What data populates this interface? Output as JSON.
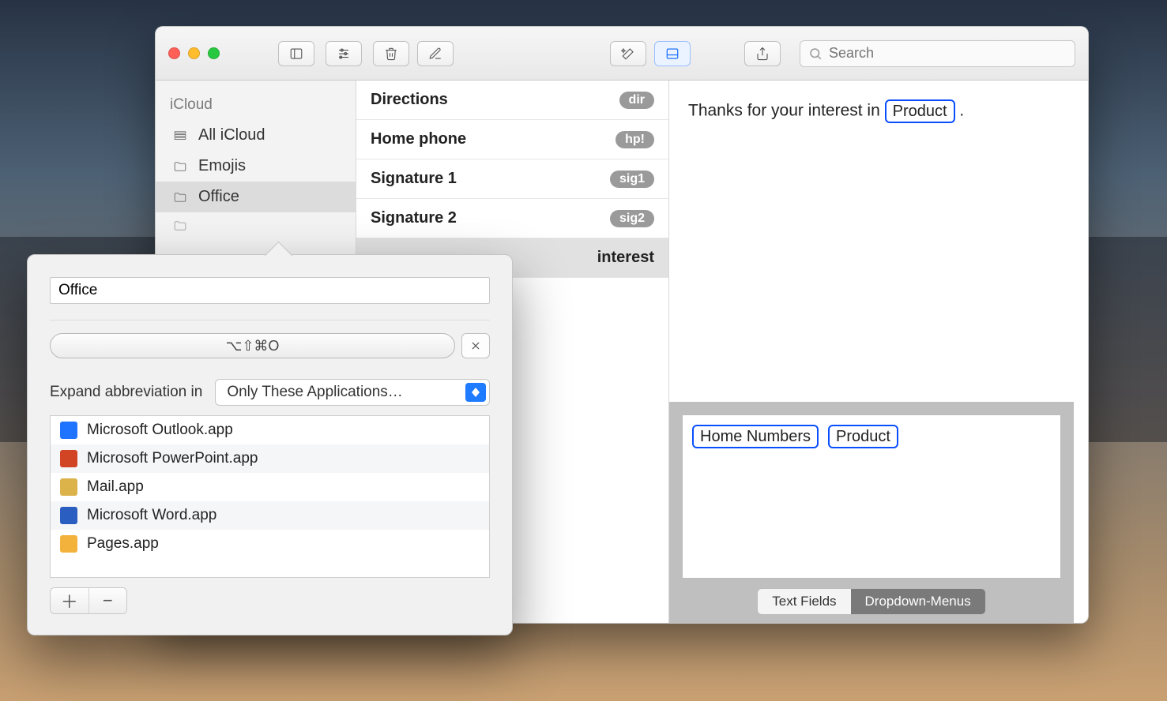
{
  "toolbar": {
    "search_placeholder": "Search"
  },
  "sidebar": {
    "group": "iCloud",
    "items": [
      {
        "label": "All iCloud"
      },
      {
        "label": "Emojis"
      },
      {
        "label": "Office"
      }
    ]
  },
  "snippets": [
    {
      "name": "Directions",
      "abbrev": "dir"
    },
    {
      "name": "Home phone",
      "abbrev": "hp!"
    },
    {
      "name": "Signature 1",
      "abbrev": "sig1"
    },
    {
      "name": "Signature 2",
      "abbrev": "sig2"
    },
    {
      "name": "Thank-interest",
      "abbrev": ""
    }
  ],
  "selected_snippet_partial": "interest",
  "expansion": {
    "prefix": "Thanks for your interest in ",
    "token": "Product",
    "suffix": " ."
  },
  "token_tray": {
    "items": [
      "Home Numbers",
      "Product"
    ],
    "segments": [
      "Text Fields",
      "Dropdown-Menus"
    ],
    "selected_segment": 1
  },
  "popover": {
    "name_value": "Office",
    "shortcut": "⌥⇧⌘O",
    "expand_label": "Expand abbreviation in",
    "scope_label": "Only These Applications…",
    "apps": [
      {
        "name": "Microsoft Outlook.app",
        "icon": "ic-out"
      },
      {
        "name": "Microsoft PowerPoint.app",
        "icon": "ic-ppt"
      },
      {
        "name": "Mail.app",
        "icon": "ic-mail"
      },
      {
        "name": "Microsoft Word.app",
        "icon": "ic-word"
      },
      {
        "name": "Pages.app",
        "icon": "ic-pages"
      }
    ]
  }
}
